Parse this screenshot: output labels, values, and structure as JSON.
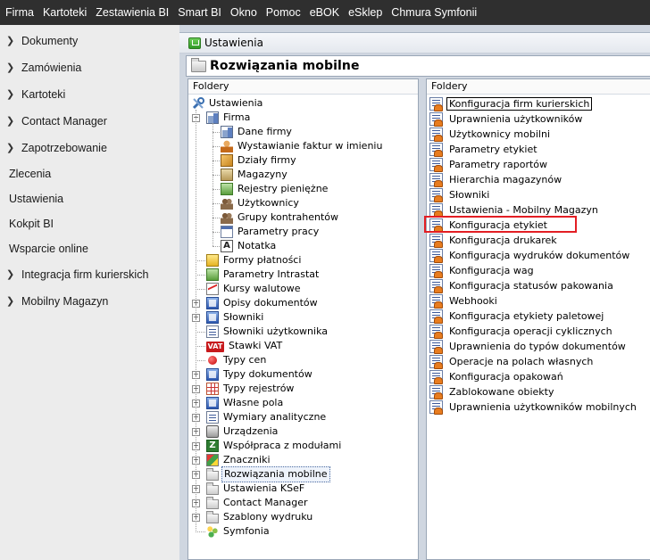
{
  "menubar": {
    "items": [
      "Firma",
      "Kartoteki",
      "Zestawienia BI",
      "Smart BI",
      "Okno",
      "Pomoc",
      "eBOK",
      "eSklep",
      "Chmura Symfonii"
    ]
  },
  "leftnav": {
    "items": [
      {
        "label": "Dokumenty",
        "chevron": true
      },
      {
        "label": "Zamówienia",
        "chevron": true
      },
      {
        "label": "Kartoteki",
        "chevron": true
      },
      {
        "label": "Contact Manager",
        "chevron": true
      },
      {
        "label": "Zapotrzebowanie",
        "chevron": true
      },
      {
        "label": "Zlecenia",
        "chevron": false
      },
      {
        "label": "Ustawienia",
        "chevron": false
      },
      {
        "label": "Kokpit BI",
        "chevron": false
      },
      {
        "label": "Wsparcie online",
        "chevron": false
      },
      {
        "label": "Integracja firm kurierskich",
        "chevron": true
      },
      {
        "label": "Mobilny Magazyn",
        "chevron": true
      }
    ]
  },
  "window": {
    "title": "Ustawienia",
    "header": "Rozwiązania mobilne"
  },
  "tree_pane": {
    "header": "Foldery",
    "root": "Ustawienia",
    "firma": "Firma",
    "firma_children": [
      {
        "label": "Dane firmy",
        "icon": "building-icon"
      },
      {
        "label": "Wystawianie faktur w imieniu",
        "icon": "person-icon"
      },
      {
        "label": "Działy firmy",
        "icon": "cube-icon"
      },
      {
        "label": "Magazyny",
        "icon": "box-icon"
      },
      {
        "label": "Rejestry pieniężne",
        "icon": "cash-register-icon"
      },
      {
        "label": "Użytkownicy",
        "icon": "users-icon"
      },
      {
        "label": "Grupy kontrahentów",
        "icon": "groups-icon"
      },
      {
        "label": "Parametry pracy",
        "icon": "calendar-icon"
      },
      {
        "label": "Notatka",
        "icon": "note-icon"
      }
    ],
    "top_items": [
      {
        "label": "Formy płatności",
        "expandable": false,
        "icon": "payment-icon"
      },
      {
        "label": "Parametry Intrastat",
        "expandable": false,
        "icon": "intrastat-icon"
      },
      {
        "label": "Kursy walutowe",
        "expandable": false,
        "icon": "currency-chart-icon"
      },
      {
        "label": "Opisy dokumentów",
        "expandable": true,
        "icon": "document-descriptions-icon"
      },
      {
        "label": "Słowniki",
        "expandable": true,
        "icon": "dictionary-icon"
      },
      {
        "label": "Słowniki użytkownika",
        "expandable": false,
        "icon": "user-dictionary-icon"
      },
      {
        "label": "Stawki VAT",
        "expandable": false,
        "icon": "vat-icon"
      },
      {
        "label": "Typy cen",
        "expandable": false,
        "icon": "price-types-icon"
      },
      {
        "label": "Typy dokumentów",
        "expandable": true,
        "icon": "document-types-icon"
      },
      {
        "label": "Typy rejestrów",
        "expandable": true,
        "icon": "register-types-icon"
      },
      {
        "label": "Własne pola",
        "expandable": true,
        "icon": "custom-fields-icon"
      },
      {
        "label": "Wymiary analityczne",
        "expandable": true,
        "icon": "analytic-dimensions-icon"
      },
      {
        "label": "Urządzenia",
        "expandable": true,
        "icon": "printer-icon"
      },
      {
        "label": "Współpraca z modułami",
        "expandable": true,
        "icon": "modules-link-icon"
      },
      {
        "label": "Znaczniki",
        "expandable": true,
        "icon": "tags-icon"
      },
      {
        "label": "Rozwiązania mobilne",
        "expandable": true,
        "icon": "folder-icon",
        "selected": true
      },
      {
        "label": "Ustawienia KSeF",
        "expandable": true,
        "icon": "folder-icon"
      },
      {
        "label": "Contact Manager",
        "expandable": true,
        "icon": "folder-icon"
      },
      {
        "label": "Szablony wydruku",
        "expandable": true,
        "icon": "folder-icon"
      },
      {
        "label": "Symfonia",
        "expandable": false,
        "icon": "symfonia-icon"
      }
    ]
  },
  "list_pane": {
    "header": "Foldery",
    "items": [
      "Konfiguracja firm kurierskich",
      "Uprawnienia użytkowników",
      "Użytkownicy mobilni",
      "Parametry etykiet",
      "Parametry raportów",
      "Hierarchia magazynów",
      "Słowniki",
      "Ustawienia - Mobilny Magazyn",
      "Konfiguracja etykiet",
      "Konfiguracja drukarek",
      "Konfiguracja wydruków dokumentów",
      "Konfiguracja wag",
      "Konfiguracja statusów pakowania",
      "Webhooki",
      "Konfiguracja etykiety paletowej",
      "Konfiguracja operacji cyklicznych",
      "Uprawnienia do typów dokumentów",
      "Operacje na polach własnych",
      "Konfiguracja opakowań",
      "Zablokowane obiekty",
      "Uprawnienia użytkowników mobilnych"
    ],
    "focused_index": 0,
    "highlighted_index": 8
  },
  "colors": {
    "menubar_bg": "#2f2f2f",
    "highlight_border": "#e31e24",
    "window_bg": "#cfd6e0"
  }
}
